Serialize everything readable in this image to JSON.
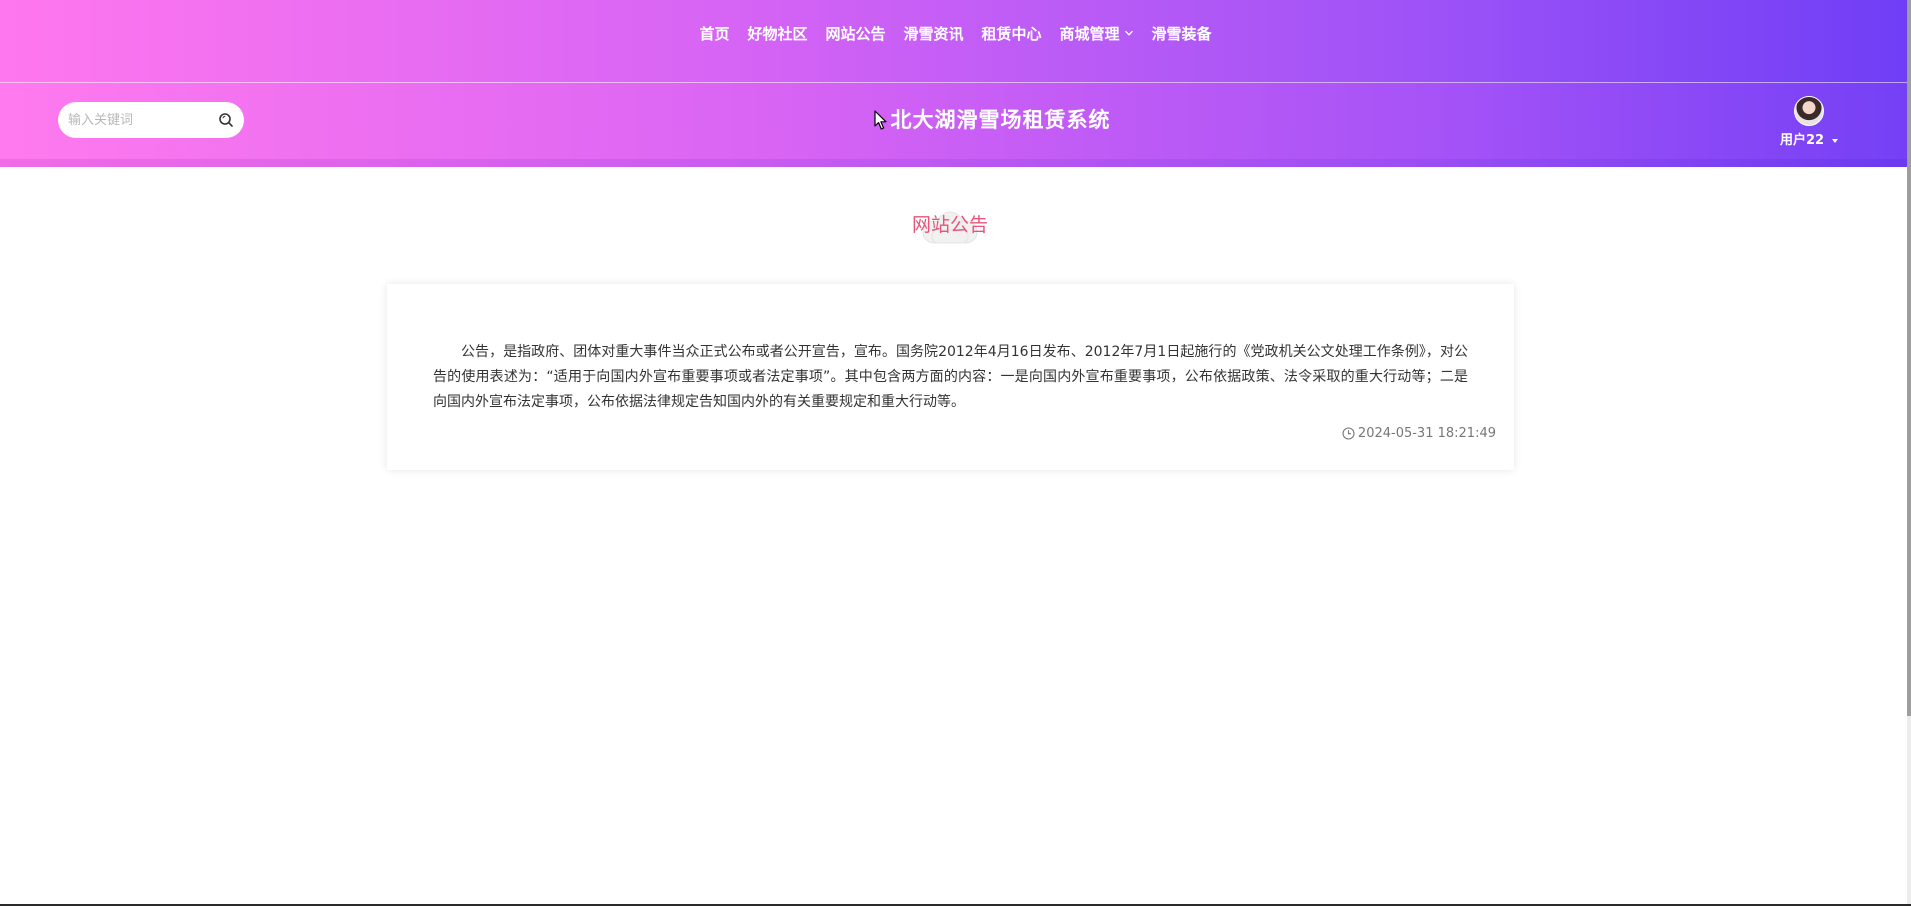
{
  "nav": {
    "items": [
      "首页",
      "好物社区",
      "网站公告",
      "滑雪资讯",
      "租赁中心",
      "商城管理",
      "滑雪装备"
    ],
    "dropdown_item_index": 5
  },
  "header": {
    "search_placeholder": "输入关键词",
    "site_title": "北大湖滑雪场租赁系统",
    "user_name": "用户22"
  },
  "section": {
    "title": "网站公告"
  },
  "notice": {
    "content": "公告，是指政府、团体对重大事件当众正式公布或者公开宣告，宣布。国务院2012年4月16日发布、2012年7月1日起施行的《党政机关公文处理工作条例》，对公告的使用表述为：“适用于向国内外宣布重要事项或者法定事项”。其中包含两方面的内容：一是向国内外宣布重要事项，公布依据政策、法令采取的重大行动等；二是向国内外宣布法定事项，公布依据法律规定告知国内外的有关重要规定和重大行动等。",
    "date": "2024-05-31 18:21:49"
  },
  "colors": {
    "gradient_start": "#ff77ee",
    "gradient_end": "#6f3ef6",
    "section_title": "#e6557b"
  },
  "icons": {
    "search": "search-icon",
    "clock": "clock-icon",
    "chevron": "chevron-down-icon"
  }
}
